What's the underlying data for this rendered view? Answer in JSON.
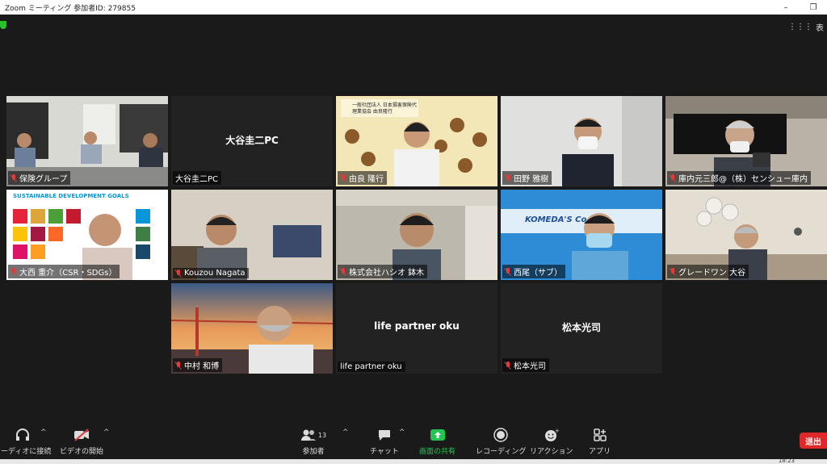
{
  "window": {
    "title": "Zoom ミーティング 参加者ID: 279855",
    "minimize": "–",
    "restore": "❐"
  },
  "view_button": {
    "label": "表"
  },
  "tiles": [
    {
      "name": "保険グループ"
    },
    {
      "name": "大谷圭二PC",
      "center": "大谷圭二PC"
    },
    {
      "name": "由良 隆行",
      "banner": "一般社団法人 日本損害保険代理業協会 由良隆行"
    },
    {
      "name": "田野 雅樹"
    },
    {
      "name": "庫内元三郎@（株）センシュー庫内"
    },
    {
      "name": "大西 重介（CSR・SDGs）",
      "banner": "SUSTAINABLE DEVELOPMENT GOALS"
    },
    {
      "name": "Kouzou  Nagata"
    },
    {
      "name": "株式会社ハシオ 鉢木"
    },
    {
      "name": "西尾（サブ）",
      "banner": "KOMEDA'S Co"
    },
    {
      "name": "グレードワン  大谷"
    },
    {
      "name": "中村 和博"
    },
    {
      "name": "life partner oku",
      "center": "life partner oku"
    },
    {
      "name": "松本光司",
      "center": "松本光司"
    }
  ],
  "toolbar": {
    "audio": "オーディオに接続",
    "video": "ビデオの開始",
    "participants": "参加者",
    "participants_count": "13",
    "chat": "チャット",
    "share": "画面の共有",
    "record": "レコーディング",
    "reactions": "リアクション",
    "apps": "アプリ",
    "leave": "退出"
  },
  "colors": {
    "active_border": "#c7e35a",
    "share_green": "#23c552",
    "leave_red": "#e02828",
    "mic_muted": "#e5393a"
  },
  "taskbar": {
    "clock": "18:23"
  }
}
